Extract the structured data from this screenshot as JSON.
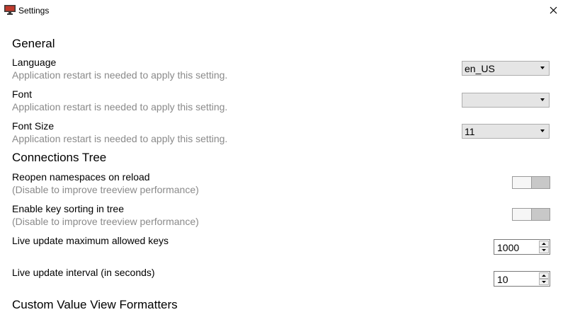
{
  "window": {
    "title": "Settings",
    "app_icon": "monitor-app-icon",
    "close_icon": "close-icon"
  },
  "general": {
    "heading": "General",
    "language": {
      "label": "Language",
      "hint": "Application restart is needed to apply this setting.",
      "value": "en_US"
    },
    "font": {
      "label": "Font",
      "hint": "Application restart is needed to apply this setting.",
      "value": ""
    },
    "font_size": {
      "label": "Font Size",
      "hint": "Application restart is needed to apply this setting.",
      "value": "11"
    }
  },
  "connections_tree": {
    "heading": "Connections Tree",
    "reopen_namespaces": {
      "label": "Reopen namespaces on reload",
      "hint": "(Disable to improve treeview performance)",
      "enabled": false
    },
    "key_sorting": {
      "label": "Enable key sorting in tree",
      "hint": "(Disable to improve treeview performance)",
      "enabled": false
    },
    "live_update_max_keys": {
      "label": "Live update maximum allowed keys",
      "value": "1000"
    },
    "live_update_interval": {
      "label": "Live update interval (in seconds)",
      "value": "10"
    }
  },
  "custom_formatters": {
    "heading": "Custom Value View Formatters"
  }
}
